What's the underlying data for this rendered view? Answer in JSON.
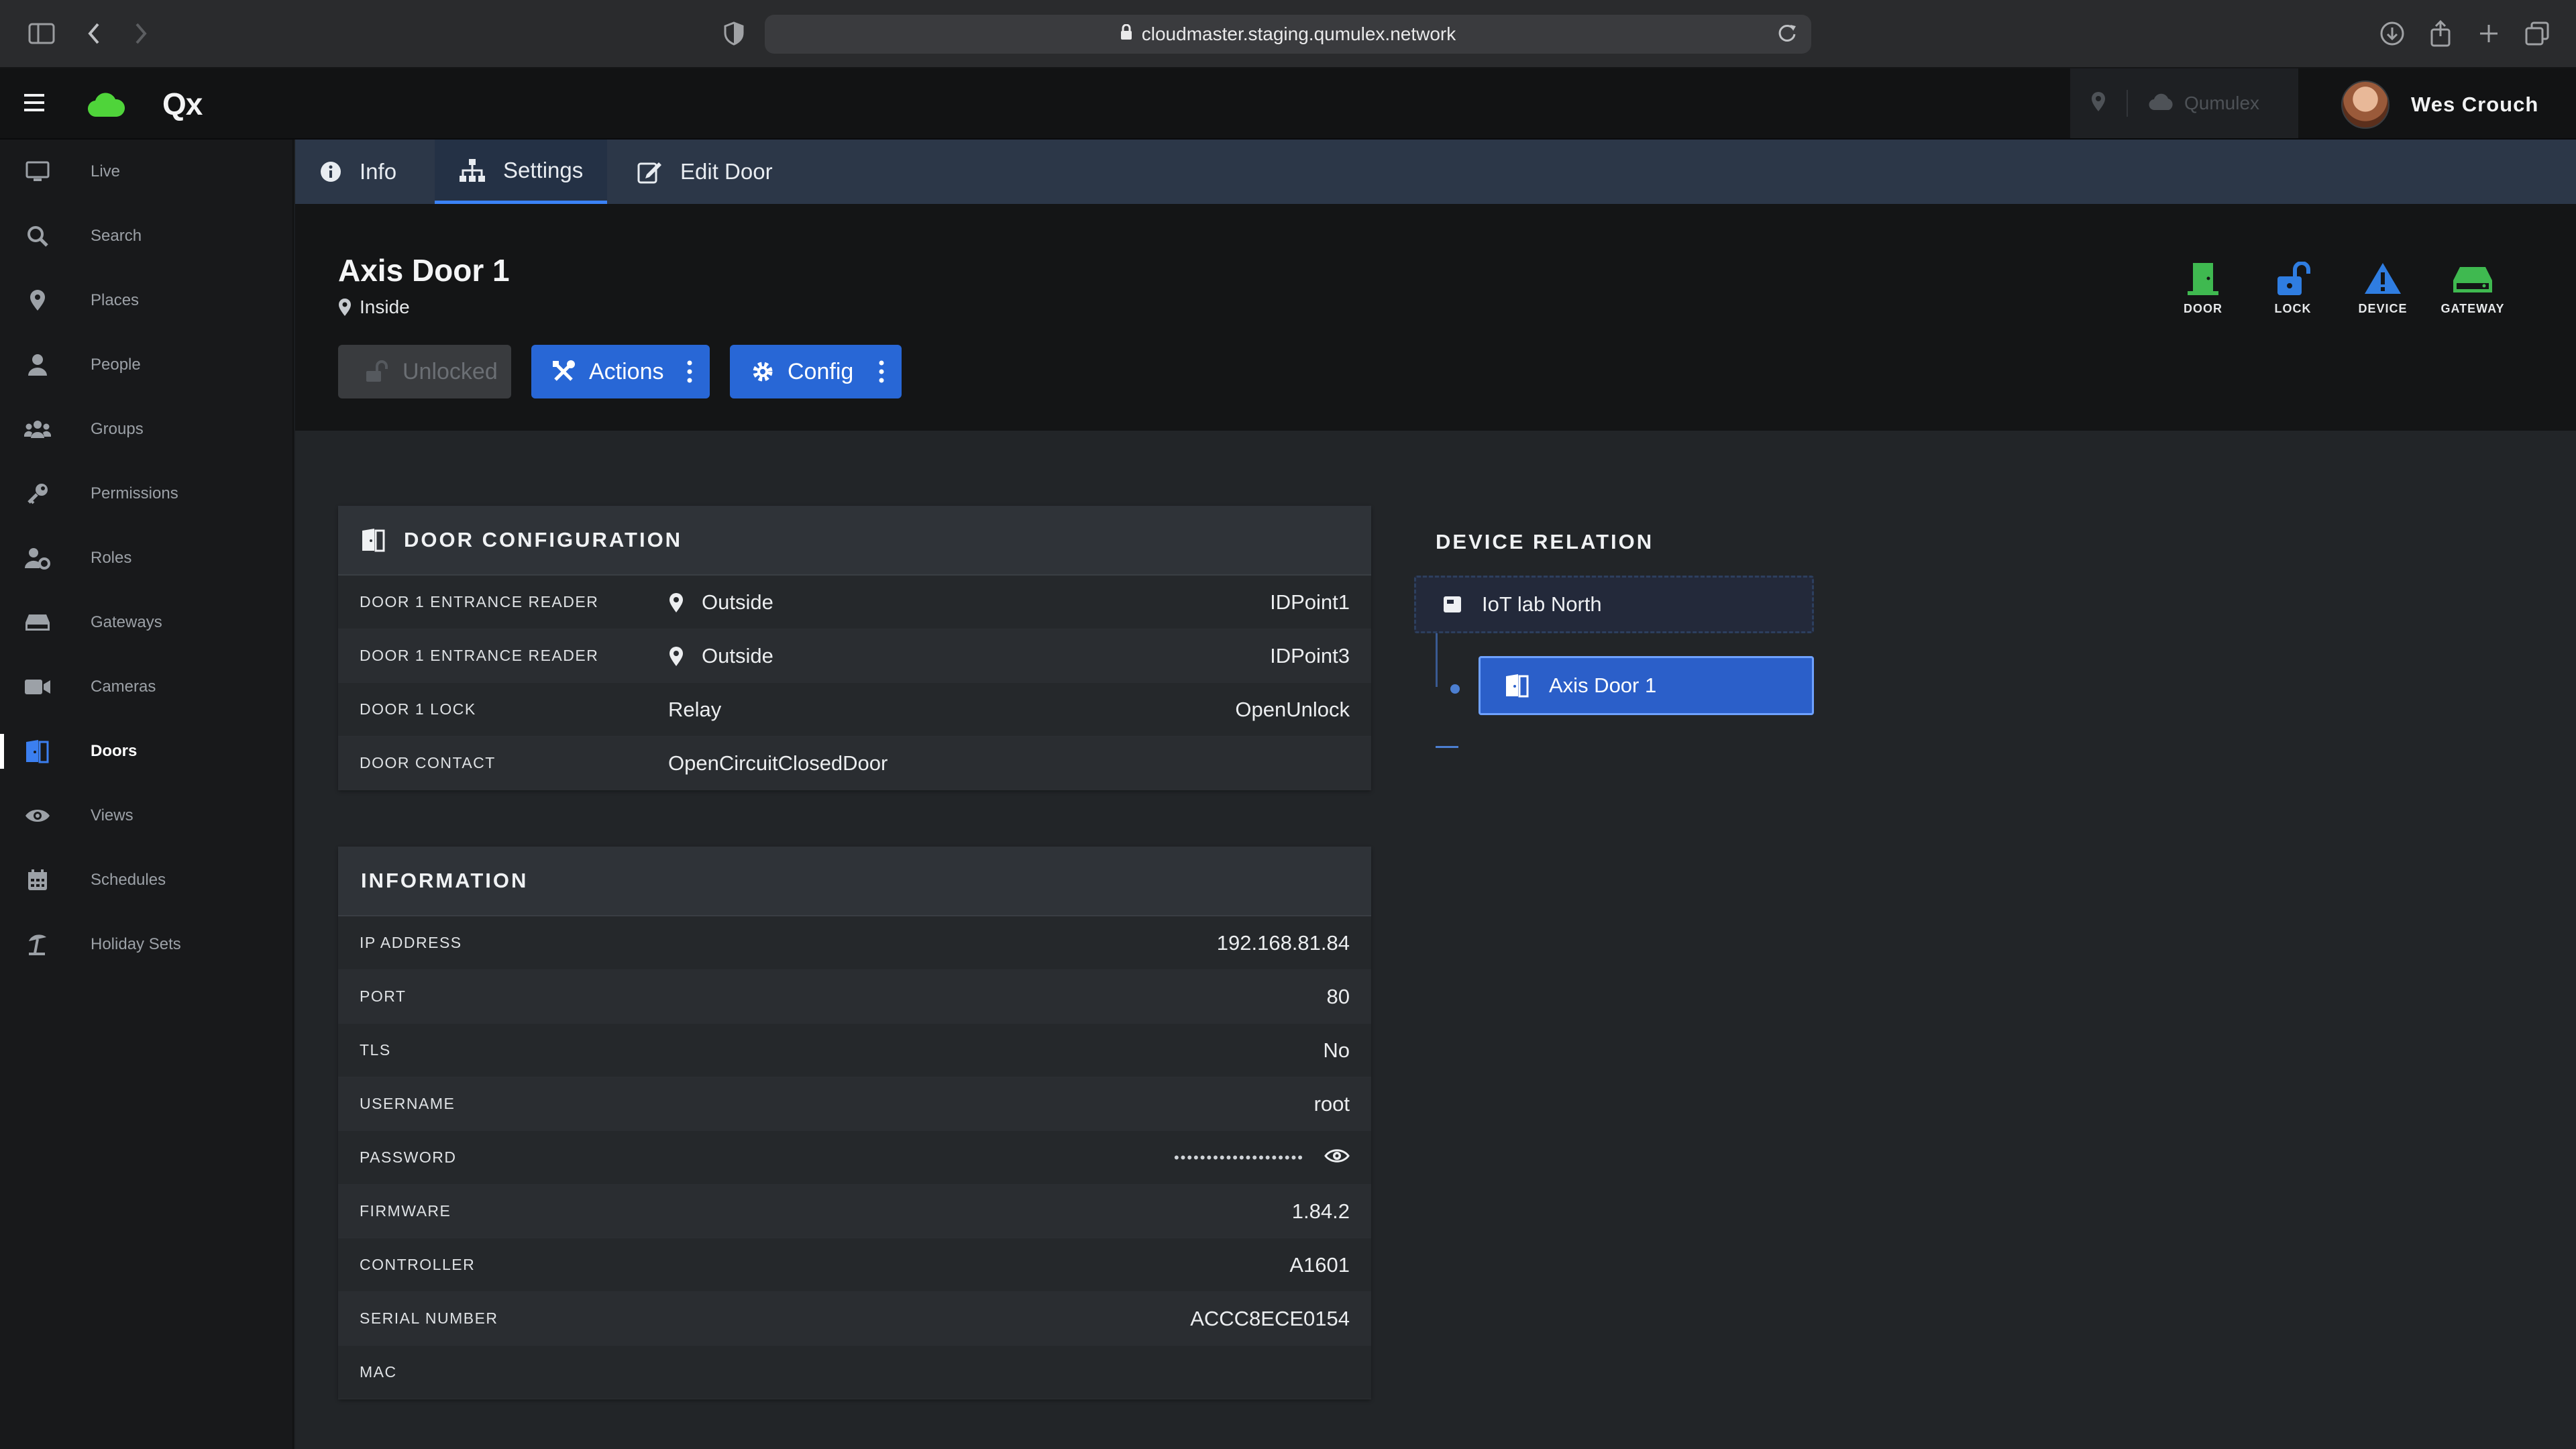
{
  "browser": {
    "url": "cloudmaster.staging.qumulex.network"
  },
  "app": {
    "brand": "Qx",
    "header_right_label": "Qumulex",
    "user_name": "Wes Crouch"
  },
  "sidebar": {
    "items": [
      {
        "label": "Live",
        "icon": "monitor-icon"
      },
      {
        "label": "Search",
        "icon": "search-icon"
      },
      {
        "label": "Places",
        "icon": "map-pin-icon"
      },
      {
        "label": "People",
        "icon": "person-icon"
      },
      {
        "label": "Groups",
        "icon": "users-icon"
      },
      {
        "label": "Permissions",
        "icon": "key-icon"
      },
      {
        "label": "Roles",
        "icon": "user-cog-icon"
      },
      {
        "label": "Gateways",
        "icon": "hdd-icon"
      },
      {
        "label": "Cameras",
        "icon": "video-camera-icon"
      },
      {
        "label": "Doors",
        "icon": "door-icon"
      },
      {
        "label": "Views",
        "icon": "eye-icon"
      },
      {
        "label": "Schedules",
        "icon": "calendar-icon"
      },
      {
        "label": "Holiday Sets",
        "icon": "umbrella-beach-icon"
      }
    ],
    "active": "Doors"
  },
  "tabs": [
    {
      "label": "Info",
      "icon": "info-circle-icon"
    },
    {
      "label": "Settings",
      "icon": "sitemap-icon"
    },
    {
      "label": "Edit Door",
      "icon": "edit-icon"
    }
  ],
  "active_tab": "Settings",
  "door": {
    "title": "Axis Door 1",
    "location": "Inside",
    "buttons": {
      "unlocked": "Unlocked",
      "actions": "Actions",
      "config": "Config"
    },
    "type_icons": [
      {
        "label": "DOOR",
        "color": "#3fb950"
      },
      {
        "label": "LOCK",
        "color": "#2f7de1"
      },
      {
        "label": "DEVICE",
        "color": "#2f7de1"
      },
      {
        "label": "GATEWAY",
        "color": "#3fb950"
      }
    ]
  },
  "door_configuration": {
    "title": "DOOR CONFIGURATION",
    "rows": [
      {
        "label": "DOOR 1 ENTRANCE READER",
        "mid": "Outside",
        "value": "IDPoint1"
      },
      {
        "label": "DOOR 1 ENTRANCE READER",
        "mid": "Outside",
        "value": "IDPoint3"
      },
      {
        "label": "DOOR 1 LOCK",
        "mid": "Relay",
        "value": "OpenUnlock"
      },
      {
        "label": "DOOR CONTACT",
        "mid": "OpenCircuitClosedDoor",
        "value": ""
      }
    ]
  },
  "information": {
    "title": "INFORMATION",
    "rows": [
      {
        "label": "IP ADDRESS",
        "value": "192.168.81.84"
      },
      {
        "label": "PORT",
        "value": "80"
      },
      {
        "label": "TLS",
        "value": "No"
      },
      {
        "label": "USERNAME",
        "value": "root"
      },
      {
        "label": "PASSWORD",
        "value": "••••••••••••••••••••"
      },
      {
        "label": "FIRMWARE",
        "value": "1.84.2"
      },
      {
        "label": "CONTROLLER",
        "value": "A1601"
      },
      {
        "label": "SERIAL NUMBER",
        "value": "ACCC8ECE0154"
      },
      {
        "label": "MAC",
        "value": ""
      }
    ]
  },
  "device_relation": {
    "title": "DEVICE RELATION",
    "parent": "IoT lab North",
    "child": "Axis Door 1"
  },
  "colors": {
    "accent": "#2867d6",
    "door_green": "#3fb950"
  }
}
